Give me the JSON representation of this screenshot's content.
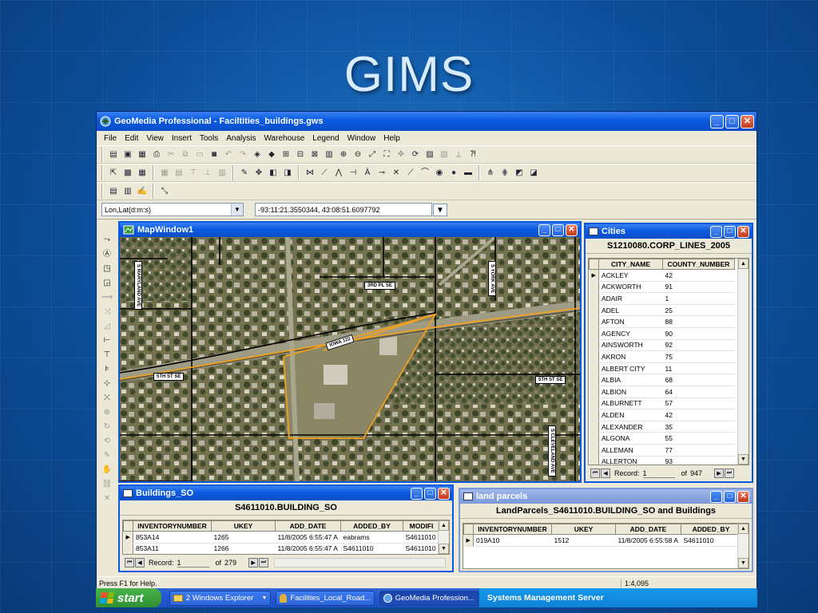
{
  "slide": {
    "title": "GIMS"
  },
  "app": {
    "title": "GeoMedia Professional - Faciltities_buildings.gws",
    "menu": [
      "File",
      "Edit",
      "View",
      "Insert",
      "Tools",
      "Analysis",
      "Warehouse",
      "Legend",
      "Window",
      "Help"
    ],
    "coord_system": "Lon,Lat(d:m:s)",
    "coord_value": "-93:11:21.3550344, 43:08:51.6097792",
    "status_text": "Press F1 for Help.",
    "scale": "1:4,095"
  },
  "map_window": {
    "title": "MapWindow1",
    "labels": {
      "s_maryland_ave": "S MARYLAND AVE",
      "third_pl_se": "3RD PL SE",
      "s_york_ave": "S YORK AVE",
      "iowa_122": "IOWA 122",
      "fifth_st_se_left": "5TH ST SE",
      "fifth_st_se_right": "5TH ST SE",
      "s_cleveland_ave": "S CLEVELAND AVE"
    }
  },
  "cities": {
    "title": "Cities",
    "table_title": "S1210080.CORP_LINES_2005",
    "columns": [
      "CITY_NAME",
      "COUNTY_NUMBER"
    ],
    "rows": [
      [
        "ACKLEY",
        "42"
      ],
      [
        "ACKWORTH",
        "91"
      ],
      [
        "ADAIR",
        "1"
      ],
      [
        "ADEL",
        "25"
      ],
      [
        "AFTON",
        "88"
      ],
      [
        "AGENCY",
        "90"
      ],
      [
        "AINSWORTH",
        "92"
      ],
      [
        "AKRON",
        "75"
      ],
      [
        "ALBERT CITY",
        "11"
      ],
      [
        "ALBIA",
        "68"
      ],
      [
        "ALBION",
        "64"
      ],
      [
        "ALBURNETT",
        "57"
      ],
      [
        "ALDEN",
        "42"
      ],
      [
        "ALEXANDER",
        "35"
      ],
      [
        "ALGONA",
        "55"
      ],
      [
        "ALLEMAN",
        "77"
      ],
      [
        "ALLERTON",
        "93"
      ]
    ],
    "record_label": "Record:",
    "record_value": "1",
    "record_of": "of",
    "record_total": "947"
  },
  "buildings": {
    "title": "Buildings_SO",
    "table_title": "S4611010.BUILDING_SO",
    "columns": [
      "INVENTORYNUMBER",
      "UKEY",
      "ADD_DATE",
      "ADDED_BY",
      "MODIFI"
    ],
    "rows": [
      [
        "853A14",
        "1265",
        "11/8/2005 6:55:47 A",
        "eabrams",
        "S4611010"
      ],
      [
        "853A11",
        "1266",
        "11/8/2005 6:55:47 A",
        "S4611010",
        "S4611010"
      ]
    ],
    "record_label": "Record:",
    "record_value": "1",
    "record_of": "of",
    "record_total": "279"
  },
  "parcels": {
    "title": "land parcels",
    "table_title": "LandParcels_S4611010.BUILDING_SO and Buildings",
    "columns": [
      "INVENTORYNUMBER",
      "UKEY",
      "ADD_DATE",
      "ADDED_BY"
    ],
    "rows": [
      [
        "019A10",
        "1512",
        "11/8/2005 6:55:58 A",
        "S4611010"
      ]
    ]
  },
  "taskbar": {
    "start": "start",
    "items": [
      "2 Windows Explorer",
      "Facilities_Local_Road...",
      "GeoMedia Profession..."
    ],
    "tray_text": "Systems Management Server"
  },
  "colors": {
    "slide_bg": "#0d4f9c",
    "title_text": "#d8ecff",
    "titlebar_active": "#0a5ae0",
    "parcel_outline": "#f0a020",
    "roads": "#000000"
  }
}
